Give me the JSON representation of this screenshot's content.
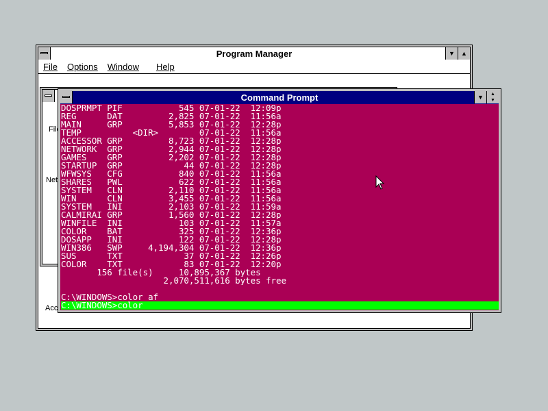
{
  "program_manager": {
    "title": "Program Manager",
    "minimize_icon": "triangle-down",
    "maximize_icon": "triangle-up",
    "menu": {
      "file": "File",
      "options": "Options",
      "window": "Window",
      "help": "Help"
    }
  },
  "group_window": {
    "labels": [
      "File",
      "Net",
      "Acc"
    ]
  },
  "command_prompt": {
    "title": "Command Prompt",
    "background_color": "#aa0055",
    "highlight_color": "#00ff00",
    "lines": [
      "DOSPRMPT PIF           545 07-01-22  12:09p",
      "REG      DAT         2,825 07-01-22  11:56a",
      "MAIN     GRP         5,853 07-01-22  12:28p",
      "TEMP          <DIR>        07-01-22  11:56a",
      "ACCESSOR GRP         8,723 07-01-22  12:28p",
      "NETWORK  GRP         2,944 07-01-22  12:28p",
      "GAMES    GRP         2,202 07-01-22  12:28p",
      "STARTUP  GRP            44 07-01-22  12:28p",
      "WFWSYS   CFG           840 07-01-22  11:56a",
      "SHARES   PWL           622 07-01-22  11:56a",
      "SYSTEM   CLN         2,110 07-01-22  11:56a",
      "WIN      CLN         3,455 07-01-22  11:56a",
      "SYSTEM   INI         2,103 07-01-22  11:59a",
      "CALMIRAI GRP         1,560 07-01-22  12:28p",
      "WINFILE  INI           103 07-01-22  11:57a",
      "COLOR    BAT           325 07-01-22  12:36p",
      "DOSAPP   INI           122 07-01-22  12:28p",
      "WIN386   SWP     4,194,304 07-01-22  12:36p",
      "SUS      TXT            37 07-01-22  12:26p",
      "COLOR    TXT            83 07-01-22  12:20p",
      "       156 file(s)     10,895,367 bytes",
      "                    2,070,511,616 bytes free",
      "",
      "C:\\WINDOWS>color af"
    ],
    "current_line": "C:\\WINDOWS>color"
  }
}
